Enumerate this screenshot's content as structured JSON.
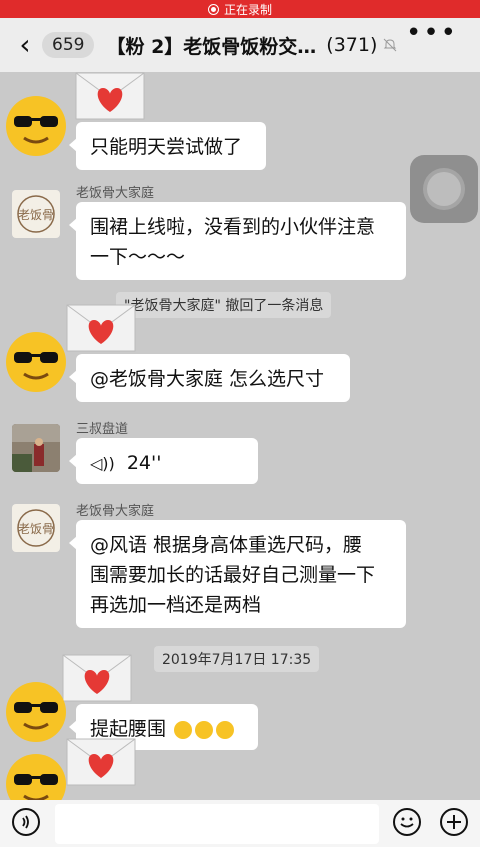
{
  "recording": {
    "label": "正在录制"
  },
  "nav": {
    "badge": "659",
    "title": "【粉 2】老饭骨饭粉交…",
    "count": "(371)"
  },
  "messages": {
    "m1": "只能明天尝试做了",
    "m2_sender": "老饭骨大家庭",
    "m2_line1": "围裙上线啦，没看到的小伙伴注意",
    "m2_line2": "一下～～～",
    "recall": "\"老饭骨大家庭\" 撤回了一条消息",
    "m3": "@老饭骨大家庭 怎么选尺寸",
    "m4_sender": "三叔盘道",
    "m4_voice": "24''",
    "m5_sender": "老饭骨大家庭",
    "m5_line1": "@风语 根据身高体重选尺码，腰",
    "m5_line2": "围需要加长的话最好自己测量一下",
    "m5_line3": "再选加一档还是两档",
    "timestamp": "2019年7月17日 17:35",
    "m6": "提起腰围"
  },
  "avatars": {
    "group_logo_text": "老饭骨"
  },
  "colors": {
    "record_bar": "#e02b2b",
    "chat_bg": "#c9c9c9",
    "bubble": "#ffffff",
    "heart": "#e53935"
  },
  "icons": [
    "back-icon",
    "mute-icon",
    "more-icon",
    "voice-icon",
    "emoji-icon",
    "plus-icon",
    "heart-envelope-icon",
    "sunglasses-emoji-icon"
  ]
}
